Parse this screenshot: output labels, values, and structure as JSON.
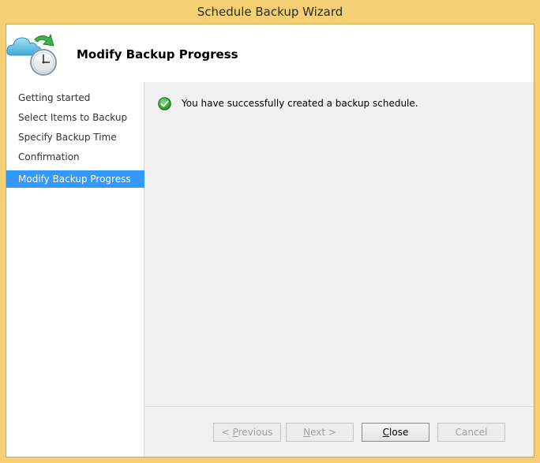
{
  "window": {
    "title": "Schedule Backup Wizard"
  },
  "header": {
    "title": "Modify Backup Progress",
    "icon": "backup-schedule-icon"
  },
  "sidebar": {
    "items": [
      {
        "label": "Getting started",
        "selected": false
      },
      {
        "label": "Select Items to Backup",
        "selected": false
      },
      {
        "label": "Specify Backup Time",
        "selected": false
      },
      {
        "label": "Confirmation",
        "selected": false
      },
      {
        "label": "Modify Backup Progress",
        "selected": true
      }
    ]
  },
  "main": {
    "status_icon": "success-check-icon",
    "status_text": "You have successfully created a backup schedule."
  },
  "footer": {
    "previous": {
      "prefix": "< ",
      "accel": "P",
      "rest": "revious",
      "enabled": false
    },
    "next": {
      "prefix": "",
      "accel": "N",
      "rest": "ext >",
      "enabled": false
    },
    "close": {
      "prefix": "",
      "accel": "C",
      "rest": "lose",
      "enabled": true
    },
    "cancel": {
      "label": "Cancel",
      "enabled": false
    }
  },
  "colors": {
    "frame": "#f5cf73",
    "selection": "#3399ff",
    "success": "#2e9e2e"
  }
}
